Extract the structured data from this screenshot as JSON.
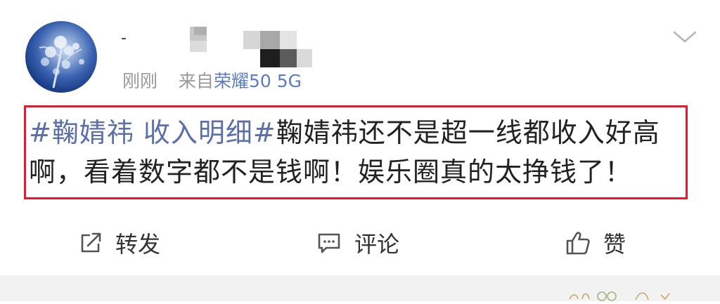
{
  "post": {
    "username_visible": "-",
    "timestamp": "刚刚",
    "source_prefix": "来自",
    "source_device": "荣耀50 5G",
    "content": {
      "hashtag": "#鞠婧祎 收入明细#",
      "body": "鞠婧祎还不是超一线都收入好高啊，看着数字都不是钱啊！娱乐圈真的太挣钱了！"
    }
  },
  "actions": {
    "repost_label": "转发",
    "comment_label": "评论",
    "like_label": "赞"
  },
  "icons": {
    "menu": "chevron-down-icon",
    "repost": "repost-icon",
    "comment": "comment-icon",
    "like": "thumbs-up-icon"
  },
  "colors": {
    "hashtag": "#5b6fa8",
    "highlight_border": "#e8192c",
    "meta_text": "#999999",
    "source_link": "#5b7cc2"
  }
}
